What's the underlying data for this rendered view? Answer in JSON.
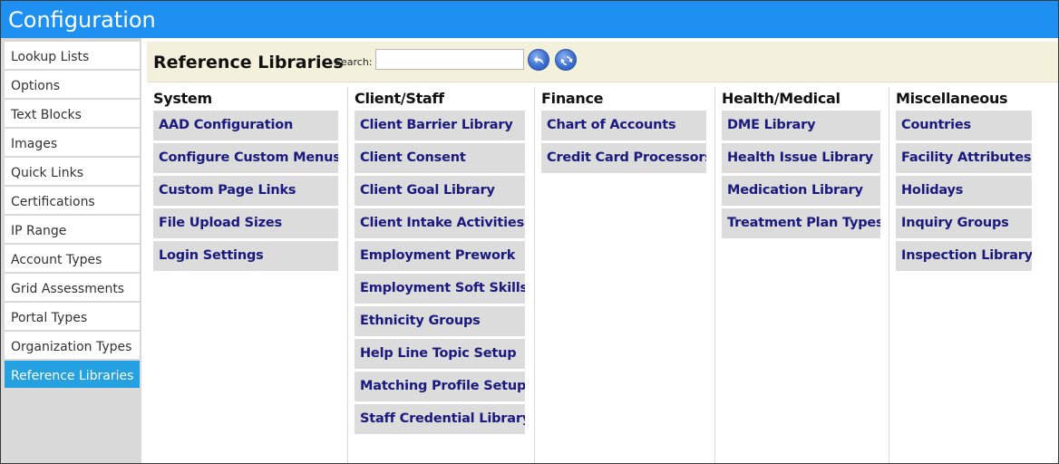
{
  "window": {
    "title": "Configuration"
  },
  "sidebar": {
    "items": [
      {
        "label": "Lookup Lists"
      },
      {
        "label": "Options"
      },
      {
        "label": "Text Blocks"
      },
      {
        "label": "Images"
      },
      {
        "label": "Quick Links"
      },
      {
        "label": "Certifications"
      },
      {
        "label": "IP Range"
      },
      {
        "label": "Account Types"
      },
      {
        "label": "Grid Assessments"
      },
      {
        "label": "Portal Types"
      },
      {
        "label": "Organization Types"
      },
      {
        "label": "Reference Libraries",
        "active": true
      }
    ]
  },
  "toolbar": {
    "title": "Reference Libraries",
    "search_label": "Search:",
    "search_value": "",
    "back_icon": "undo-arrow-icon",
    "refresh_icon": "refresh-icon"
  },
  "columns": [
    {
      "heading": "System",
      "items": [
        "AAD Configuration",
        "Configure Custom Menus",
        "Custom Page Links",
        "File Upload Sizes",
        "Login Settings"
      ]
    },
    {
      "heading": "Client/Staff",
      "items": [
        "Client Barrier Library",
        "Client Consent",
        "Client Goal Library",
        "Client Intake Activities",
        "Employment Prework",
        "Employment Soft Skills",
        "Ethnicity Groups",
        "Help Line Topic Setup",
        "Matching Profile Setup",
        "Staff Credential Library"
      ]
    },
    {
      "heading": "Finance",
      "items": [
        "Chart of Accounts",
        "Credit Card Processors"
      ]
    },
    {
      "heading": "Health/Medical",
      "items": [
        "DME Library",
        "Health Issue Library",
        "Medication Library",
        "Treatment Plan Types"
      ]
    },
    {
      "heading": "Miscellaneous",
      "items": [
        "Countries",
        "Facility Attributes",
        "Holidays",
        "Inquiry Groups",
        "Inspection Library"
      ]
    }
  ],
  "colors": {
    "titlebar": "#1e90f2",
    "active_sidebar": "#25a0e0",
    "toolbar_bg": "#f3f1dc",
    "link_text": "#1a1a7e",
    "item_bg": "#dcdcdc"
  }
}
